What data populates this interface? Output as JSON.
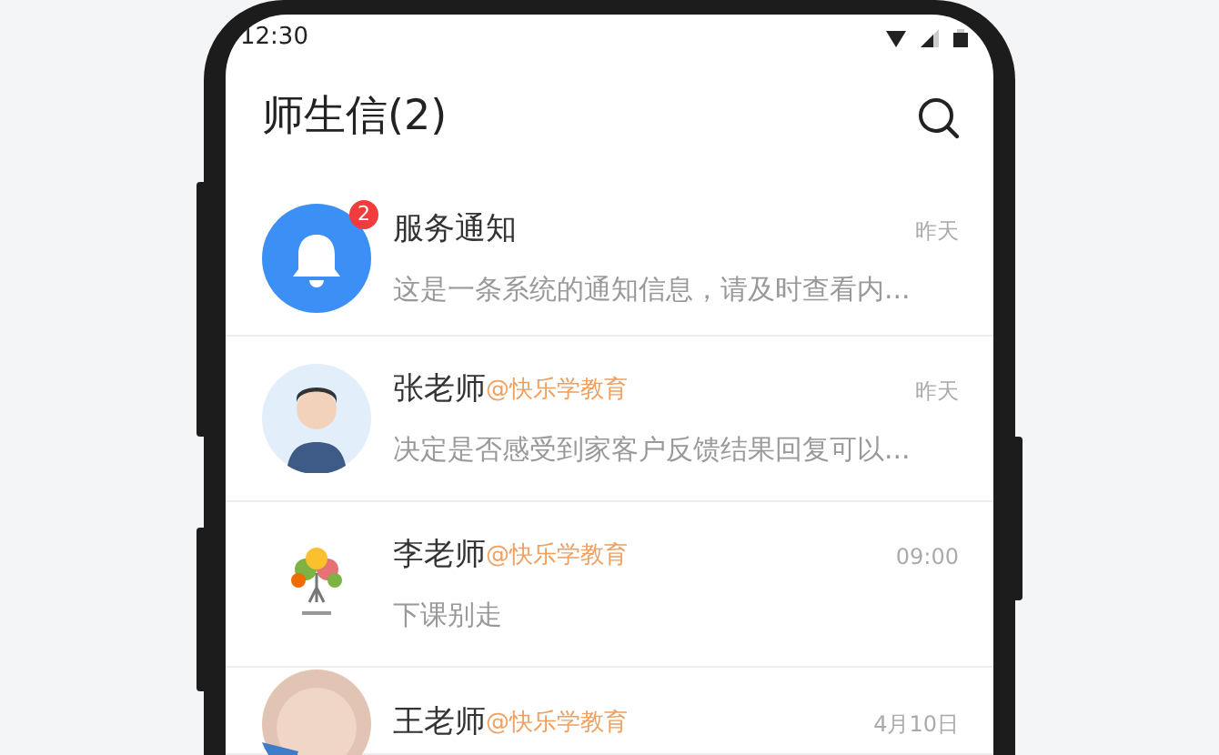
{
  "status_bar": {
    "time": "12:30"
  },
  "header": {
    "title": "师生信(2)"
  },
  "conversations": [
    {
      "kind": "bell",
      "badge": "2",
      "name": "服务通知",
      "time": "昨天",
      "preview": "这是一条系统的通知信息，请及时查看内..."
    },
    {
      "kind": "person",
      "name": "张老师",
      "tag": "@快乐学教育",
      "time": "昨天",
      "preview": "决定是否感受到家客户反馈结果回复可以..."
    },
    {
      "kind": "tree",
      "name": "李老师",
      "tag": "@快乐学教育",
      "time": "09:00",
      "preview": "下课别走"
    },
    {
      "kind": "baby",
      "name": "王老师",
      "tag": "@快乐学教育",
      "time": "4月10日"
    }
  ]
}
